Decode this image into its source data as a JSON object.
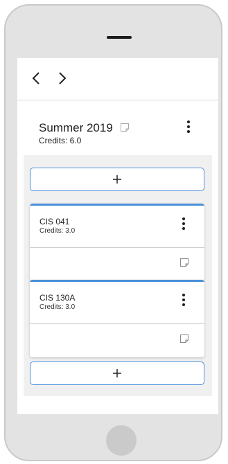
{
  "nav": {
    "back_icon": "chevron-left-icon",
    "forward_icon": "chevron-right-icon"
  },
  "term": {
    "title": "Summer 2019",
    "credits_text": "Credits:  6.0",
    "note_icon": "note-icon",
    "menu_icon": "more-vertical-icon"
  },
  "add_button_icon": "plus-icon",
  "courses": [
    {
      "code": "CIS 041",
      "credits_text": "Credits: 3.0"
    },
    {
      "code": "CIS 130A",
      "credits_text": "Credits: 3.0"
    }
  ],
  "colors": {
    "accent": "#4a90d9",
    "panel": "#f0f0f0",
    "device": "#e3e3e3"
  }
}
